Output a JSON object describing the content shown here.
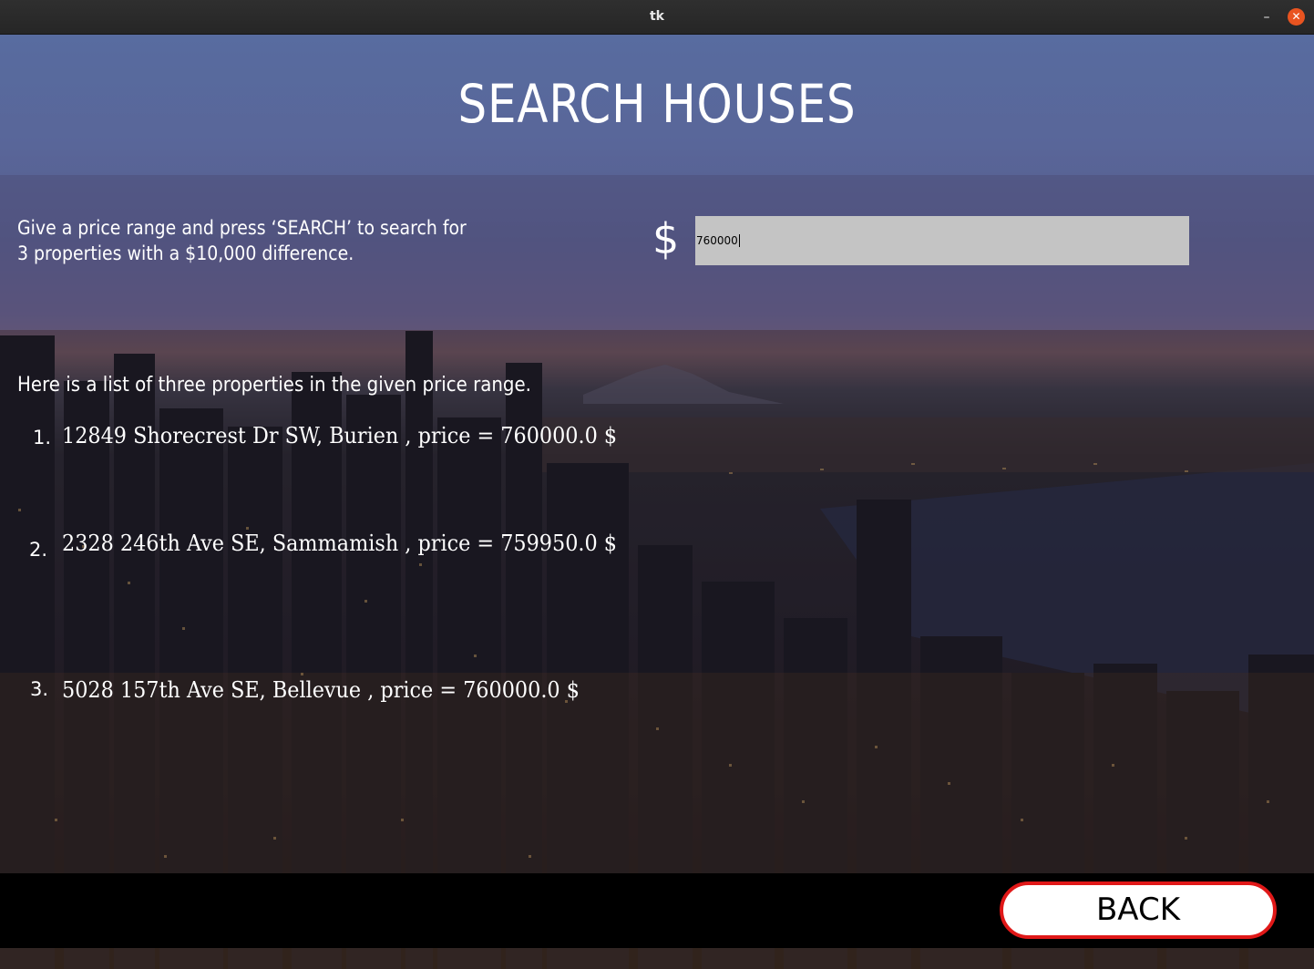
{
  "window": {
    "title": "tk",
    "minimize_glyph": "–",
    "close_glyph": "✕"
  },
  "header": {
    "title": "SEARCH HOUSES"
  },
  "search": {
    "instructions": "Give a price range and press ‘SEARCH’ to search for 3 properties with a $10,000 difference.",
    "currency_symbol": "$",
    "price_value": "760000"
  },
  "results": {
    "heading": "Here is a list of three properties in the given price range.",
    "items": [
      {
        "number": "1.",
        "text": "12849 Shorecrest Dr SW, Burien , price = 760000.0 $"
      },
      {
        "number": "2.",
        "text": "2328 246th Ave SE, Sammamish , price = 759950.0 $"
      },
      {
        "number": "3.",
        "text": "5028 157th Ave SE, Bellevue , price = 760000.0 $"
      }
    ]
  },
  "footer": {
    "back_label": "BACK"
  },
  "colors": {
    "close_button": "#e95420",
    "back_border": "#e01818",
    "input_background": "#c4c4c4"
  }
}
